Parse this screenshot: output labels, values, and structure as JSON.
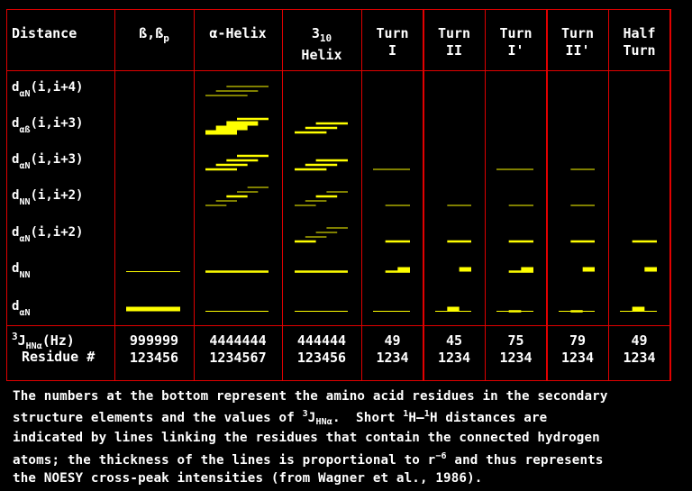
{
  "header": {
    "distance": "Distance",
    "columns": [
      {
        "id": "beta",
        "label": "ß,ß",
        "sub": "p",
        "label2": "",
        "residues": 6
      },
      {
        "id": "alpha",
        "label": "α-Helix",
        "sub": "",
        "label2": "",
        "residues": 7
      },
      {
        "id": "h310",
        "label": "3",
        "sub": "10",
        "label2": "Helix",
        "residues": 6
      },
      {
        "id": "turn1",
        "label": "Turn",
        "sub": "",
        "label2": "I",
        "residues": 4
      },
      {
        "id": "turn2",
        "label": "Turn",
        "sub": "",
        "label2": "II",
        "residues": 4
      },
      {
        "id": "turn1p",
        "label": "Turn",
        "sub": "",
        "label2": "I'",
        "residues": 4
      },
      {
        "id": "turn2p",
        "label": "Turn",
        "sub": "",
        "label2": "II'",
        "residues": 4
      },
      {
        "id": "half",
        "label": "Half",
        "sub": "",
        "label2": "Turn",
        "residues": 4
      }
    ]
  },
  "rows": [
    {
      "d": "d",
      "sub": "αN",
      "range": "(i,i+4)"
    },
    {
      "d": "d",
      "sub": "αß",
      "range": "(i,i+3)"
    },
    {
      "d": "d",
      "sub": "αN",
      "range": "(i,i+3)"
    },
    {
      "d": "d",
      "sub": "NN",
      "range": "(i,i+2)"
    },
    {
      "d": "d",
      "sub": "αN",
      "range": "(i,i+2)"
    },
    {
      "d": "d",
      "sub": "NN",
      "range": ""
    },
    {
      "d": "d",
      "sub": "αN",
      "range": ""
    }
  ],
  "footer": {
    "j_label_sup": "3",
    "j_label": "J",
    "j_label_sub": "HNα",
    "j_label_unit": "(Hz)",
    "residue_label": "Residue #",
    "j_values": [
      "999999",
      "4444444",
      "444444",
      "49",
      "45",
      "75",
      "79",
      "49"
    ],
    "residue_numbers": [
      "123456",
      "1234567",
      "123456",
      "1234",
      "1234",
      "1234",
      "1234",
      "1234"
    ]
  },
  "caption": {
    "line1": "The numbers at the bottom represent the amino acid residues in the secondary",
    "line2_a": "structure elements and the values of ",
    "line2_sup": "3",
    "line2_b": "J",
    "line2_sub": "HNα",
    "line2_c": ".  Short ",
    "line2_sup2": "1",
    "line2_d": "H–",
    "line2_sup3": "1",
    "line2_e": "H distances are",
    "line3": "indicated by lines linking the residues that contain the connected hydrogen",
    "line4_a": "atoms; the thickness of the lines is proportional to r",
    "line4_sup": "−6",
    "line4_b": " and thus represents",
    "line5": "the NOESY cross-peak intensities (from Wagner et al., 1986)."
  },
  "connections": {
    "note": "each entry: [row, column, from_residue, to_residue, intensity 1=weak 2=medium 3=strong]",
    "colors": {
      "line": "#ffff00",
      "grid": "#e00000",
      "text": "#ffffff",
      "background": "#000000"
    },
    "items": [
      [
        0,
        "alpha",
        3,
        7,
        1
      ],
      [
        0,
        "alpha",
        2,
        6,
        1
      ],
      [
        0,
        "alpha",
        1,
        5,
        1
      ],
      [
        1,
        "alpha",
        4,
        7,
        2
      ],
      [
        1,
        "alpha",
        3,
        6,
        3
      ],
      [
        1,
        "alpha",
        2,
        5,
        3
      ],
      [
        1,
        "alpha",
        1,
        4,
        3
      ],
      [
        1,
        "h310",
        3,
        6,
        2
      ],
      [
        1,
        "h310",
        2,
        5,
        2
      ],
      [
        1,
        "h310",
        1,
        4,
        2
      ],
      [
        2,
        "alpha",
        4,
        7,
        2
      ],
      [
        2,
        "alpha",
        3,
        6,
        2
      ],
      [
        2,
        "alpha",
        2,
        5,
        2
      ],
      [
        2,
        "alpha",
        1,
        4,
        2
      ],
      [
        2,
        "h310",
        3,
        6,
        2
      ],
      [
        2,
        "h310",
        2,
        5,
        2
      ],
      [
        2,
        "h310",
        1,
        4,
        2
      ],
      [
        2,
        "turn1",
        1,
        4,
        1
      ],
      [
        2,
        "turn1p",
        1,
        4,
        1
      ],
      [
        2,
        "turn2p",
        2,
        4,
        1
      ],
      [
        3,
        "alpha",
        5,
        7,
        1
      ],
      [
        3,
        "alpha",
        4,
        6,
        1
      ],
      [
        3,
        "alpha",
        3,
        5,
        2
      ],
      [
        3,
        "alpha",
        2,
        4,
        1
      ],
      [
        3,
        "alpha",
        1,
        3,
        1
      ],
      [
        3,
        "h310",
        4,
        6,
        1
      ],
      [
        3,
        "h310",
        3,
        5,
        2
      ],
      [
        3,
        "h310",
        2,
        4,
        1
      ],
      [
        3,
        "h310",
        1,
        3,
        1
      ],
      [
        3,
        "turn1",
        2,
        4,
        1
      ],
      [
        3,
        "turn2",
        2,
        4,
        1
      ],
      [
        3,
        "turn1p",
        2,
        4,
        1
      ],
      [
        3,
        "turn2p",
        2,
        4,
        1
      ],
      [
        4,
        "h310",
        4,
        6,
        1
      ],
      [
        4,
        "h310",
        3,
        5,
        1
      ],
      [
        4,
        "h310",
        2,
        4,
        1
      ],
      [
        4,
        "h310",
        1,
        3,
        2
      ],
      [
        4,
        "turn1",
        2,
        4,
        2
      ],
      [
        4,
        "turn2",
        2,
        4,
        2
      ],
      [
        4,
        "turn1p",
        2,
        4,
        2
      ],
      [
        4,
        "turn2p",
        2,
        4,
        2
      ],
      [
        4,
        "half",
        2,
        4,
        2
      ],
      [
        5,
        "beta",
        1,
        6,
        1
      ],
      [
        5,
        "alpha",
        1,
        7,
        2
      ],
      [
        5,
        "h310",
        1,
        6,
        2
      ],
      [
        5,
        "turn1",
        2,
        4,
        2
      ],
      [
        5,
        "turn1",
        3,
        4,
        3
      ],
      [
        5,
        "turn2",
        3,
        4,
        3
      ],
      [
        5,
        "turn1p",
        2,
        4,
        2
      ],
      [
        5,
        "turn1p",
        3,
        4,
        3
      ],
      [
        5,
        "turn2p",
        3,
        4,
        3
      ],
      [
        5,
        "half",
        3,
        4,
        3
      ],
      [
        6,
        "beta",
        1,
        6,
        3
      ],
      [
        6,
        "alpha",
        1,
        7,
        1
      ],
      [
        6,
        "h310",
        1,
        6,
        1
      ],
      [
        6,
        "turn1",
        1,
        4,
        1
      ],
      [
        6,
        "turn2",
        1,
        4,
        1
      ],
      [
        6,
        "turn2",
        2,
        3,
        3
      ],
      [
        6,
        "turn1p",
        1,
        4,
        1
      ],
      [
        6,
        "turn1p",
        2,
        3,
        2
      ],
      [
        6,
        "turn2p",
        1,
        4,
        1
      ],
      [
        6,
        "turn2p",
        2,
        3,
        2
      ],
      [
        6,
        "half",
        1,
        4,
        1
      ],
      [
        6,
        "half",
        2,
        3,
        3
      ]
    ]
  }
}
